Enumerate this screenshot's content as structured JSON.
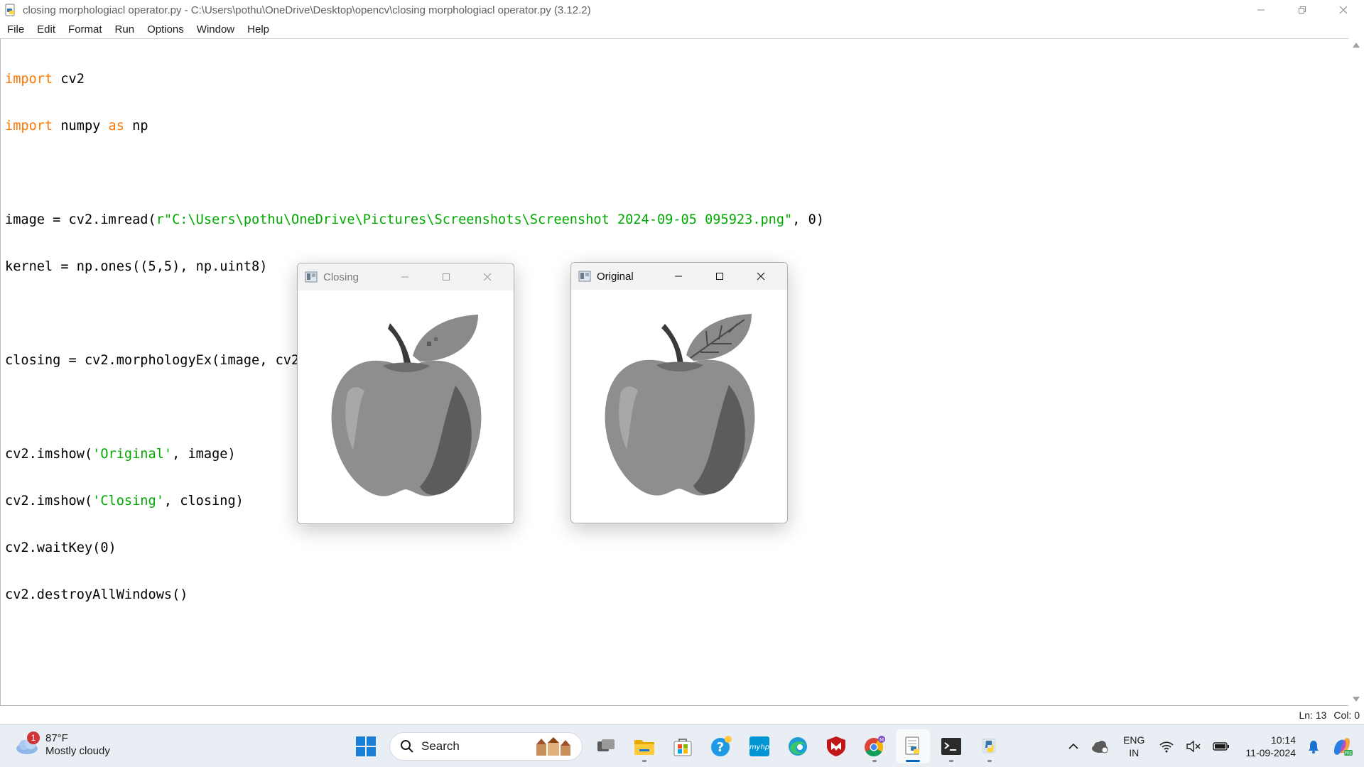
{
  "window": {
    "title": "closing morphologiacl operator.py - C:\\Users\\pothu\\OneDrive\\Desktop\\opencv\\closing morphologiacl operator.py (3.12.2)"
  },
  "menu": {
    "items": [
      {
        "label": "File"
      },
      {
        "label": "Edit"
      },
      {
        "label": "Format"
      },
      {
        "label": "Run"
      },
      {
        "label": "Options"
      },
      {
        "label": "Window"
      },
      {
        "label": "Help"
      }
    ]
  },
  "code": {
    "lines": [
      {
        "kw": "import",
        "rest": " cv2"
      },
      {
        "kw": "import",
        "mid": " numpy ",
        "kw2": "as",
        "rest": " np"
      },
      {
        "text": ""
      },
      {
        "pre": "image = cv2.imread(",
        "str": "r\"C:\\Users\\pothu\\OneDrive\\Pictures\\Screenshots\\Screenshot 2024-09-05 095923.png\"",
        "post": ", 0)"
      },
      {
        "text": "kernel = np.ones((5,5), np.uint8)"
      },
      {
        "text": ""
      },
      {
        "text": "closing = cv2.morphologyEx(image, cv2.MORPH_CLOSE, kernel)"
      },
      {
        "text": ""
      },
      {
        "pre": "cv2.imshow(",
        "str": "'Original'",
        "post": ", image)"
      },
      {
        "pre": "cv2.imshow(",
        "str": "'Closing'",
        "post": ", closing)"
      },
      {
        "text": "cv2.waitKey(0)"
      },
      {
        "text": "cv2.destroyAllWindows()"
      }
    ]
  },
  "status": {
    "line": "Ln: 13",
    "col": "Col: 0"
  },
  "imgwindows": {
    "closing": {
      "title": "Closing"
    },
    "original": {
      "title": "Original"
    }
  },
  "taskbar": {
    "weather": {
      "temp": "87°F",
      "condition": "Mostly cloudy",
      "badge": "1"
    },
    "search_placeholder": "Search",
    "apps": [
      "windows-start",
      "task-view",
      "file-explorer",
      "microsoft-store",
      "help",
      "myhp",
      "edge",
      "mcafee",
      "chrome",
      "idle-editor",
      "terminal",
      "python"
    ],
    "tray": {
      "lang1": "ENG",
      "lang2": "IN",
      "time": "10:14",
      "date": "11-09-2024"
    }
  },
  "colors": {
    "keyword": "#ff7700",
    "string": "#00aa00",
    "taskbar_bg": "#e9eef4",
    "accent": "#0067c0"
  }
}
